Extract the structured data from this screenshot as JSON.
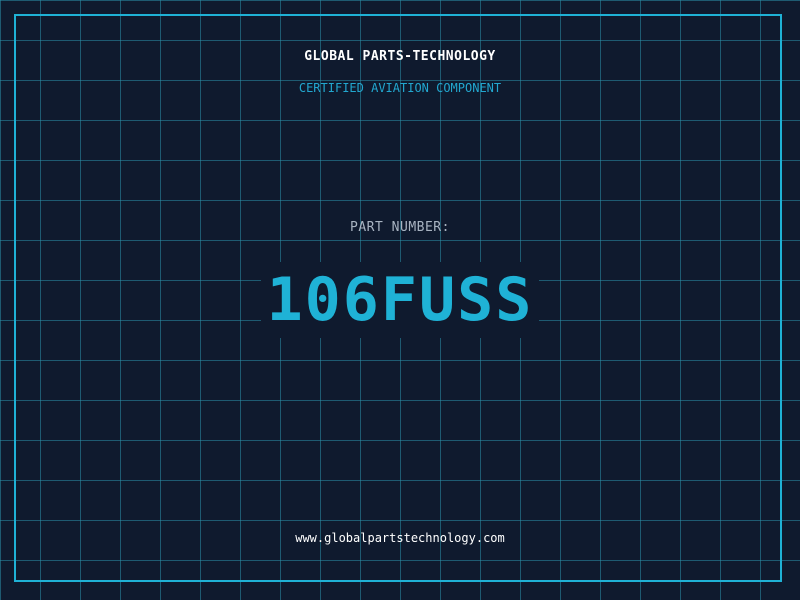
{
  "brand": {
    "name": "GLOBAL PARTS-TECHNOLOGY",
    "tagline": "CERTIFIED AVIATION COMPONENT"
  },
  "part": {
    "label": "PART NUMBER:",
    "number": "106FUSS"
  },
  "footer": {
    "url": "www.globalpartstechnology.com"
  },
  "colors": {
    "background": "#0f1a2e",
    "grid": "#2a8fa8",
    "accent": "#1fb2d6",
    "label": "#a9b4c2",
    "text": "#ffffff"
  }
}
